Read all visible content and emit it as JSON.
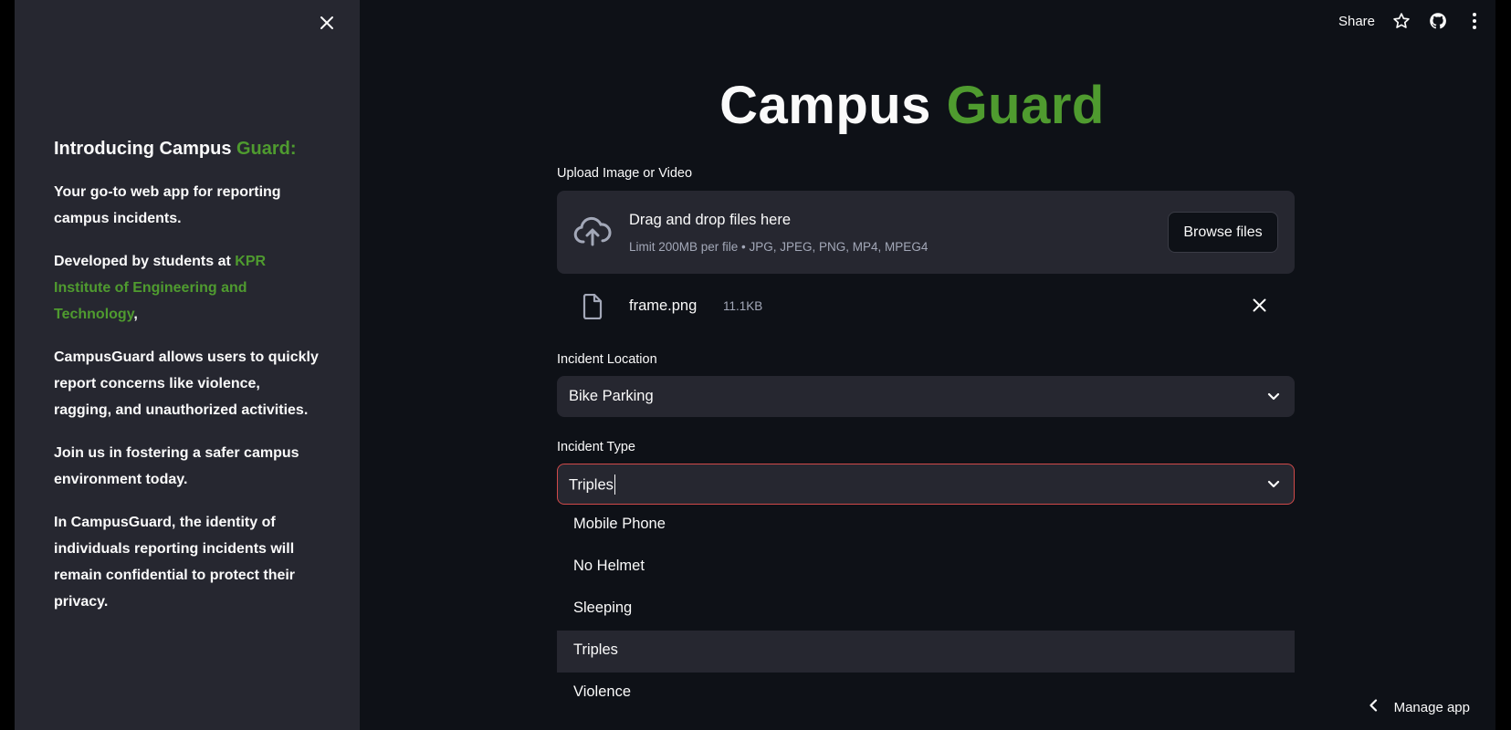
{
  "sidebar": {
    "heading_prefix": "Introducing Campus ",
    "heading_accent": "Guard:",
    "p1": "Your go-to web app for reporting campus incidents.",
    "p2_prefix": "Developed by students at ",
    "p2_accent": "KPR Institute of Engineering and Technology",
    "p2_suffix": ",",
    "p3": "CampusGuard allows users to quickly report concerns like violence, ragging, and unauthorized activities.",
    "p4": "Join us in fostering a safer campus environment today.",
    "p5": "In CampusGuard, the identity of individuals reporting incidents will remain confidential to protect their privacy.",
    "close_icon": "close-icon"
  },
  "topbar": {
    "share_label": "Share",
    "icons": [
      "star-icon",
      "github-icon",
      "more-vertical-icon"
    ]
  },
  "title": {
    "part1": "Campus ",
    "part2": "Guard"
  },
  "upload": {
    "label": "Upload Image or Video",
    "drop_title": "Drag and drop files here",
    "drop_sub": "Limit 200MB per file • JPG, JPEG, PNG, MP4, MPEG4",
    "browse_label": "Browse files",
    "file_name": "frame.png",
    "file_size": "11.1KB"
  },
  "location": {
    "label": "Incident Location",
    "value": "Bike Parking"
  },
  "type": {
    "label": "Incident Type",
    "value": "Triples",
    "options": [
      "Mobile Phone",
      "No Helmet",
      "Sleeping",
      "Triples",
      "Violence"
    ],
    "highlighted": "Triples"
  },
  "manage_label": "Manage app",
  "colors": {
    "accent_green": "#4f9b2f",
    "focus_red": "#d14a4a",
    "bg": "#0e1117",
    "panel": "#262730"
  }
}
